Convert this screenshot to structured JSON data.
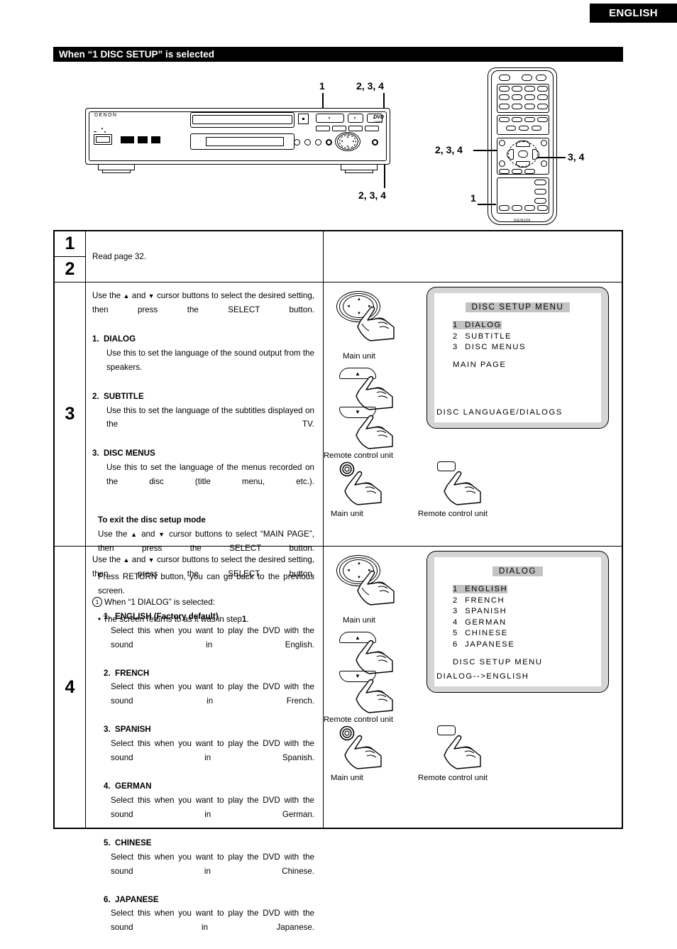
{
  "header": {
    "language_tab": "ENGLISH",
    "section_title": "When “1 DISC SETUP” is selected"
  },
  "diagram": {
    "player_brand": "DENON",
    "dvd_logo": "DVD",
    "dvd_logo_sub": "VIDEO",
    "remote_brand": "DENON",
    "callouts": {
      "player_top_left": "1",
      "player_top_right": "2, 3, 4",
      "player_bottom": "2, 3, 4",
      "remote_left": "2, 3, 4",
      "remote_right": "3, 4",
      "remote_bottom_left": "1"
    }
  },
  "steps": {
    "step1_number": "1",
    "step2_number": "2",
    "step3_number": "3",
    "step4_number": "4",
    "step12_text": "Read page 32.",
    "step3": {
      "intro_line1": "Use the",
      "intro_and": "and",
      "intro_line2": "cursor buttons to select the desired setting, then press the SELECT button.",
      "items": [
        {
          "num": "1.",
          "title": "DIALOG",
          "body": "Use this to set the language of the sound output from the speakers."
        },
        {
          "num": "2.",
          "title": "SUBTITLE",
          "body": "Use this to set the language of the subtitles displayed on the TV."
        },
        {
          "num": "3.",
          "title": "DISC MENUS",
          "body": "Use this to set the language of the menus recorded on the disc (title menu, etc.)."
        }
      ],
      "exit_heading": "To exit the disc setup mode",
      "exit_p1": "cursor buttons to select “MAIN PAGE”, then press the SELECT button.",
      "exit_p2": "Press RETURN button, you can go back to the previous screen.",
      "exit_bullet_pre": "• The screen returns to as it was in step",
      "exit_bullet_num": "1",
      "exit_bullet_post": "."
    },
    "step4": {
      "intro_line2": "cursor buttons to select the desired setting, then press the SELECT button.",
      "condition": "When “1 DIALOG” is selected:",
      "condition_marker": "1",
      "items": [
        {
          "num": "1.",
          "title": "ENGLISH (Factory default)",
          "body": "Select this when you want to play the DVD with the sound in English."
        },
        {
          "num": "2.",
          "title": "FRENCH",
          "body": "Select this when you want to play the DVD with the sound in French."
        },
        {
          "num": "3.",
          "title": "SPANISH",
          "body": "Select this when you want to play the DVD with the sound in Spanish."
        },
        {
          "num": "4.",
          "title": "GERMAN",
          "body": "Select this when you want to play the DVD with the sound in German."
        },
        {
          "num": "5.",
          "title": "CHINESE",
          "body": "Select this when you want to play the DVD with the sound in Chinese."
        },
        {
          "num": "6.",
          "title": "JAPANESE",
          "body": "Select this when you want to play the DVD with the sound in Japanese."
        }
      ]
    }
  },
  "figures": {
    "main_unit_label": "Main unit",
    "remote_label": "Remote control unit"
  },
  "osd_disc_setup": {
    "title": "DISC SETUP MENU",
    "items": [
      {
        "num": "1",
        "label": "DIALOG",
        "highlighted": true
      },
      {
        "num": "2",
        "label": "SUBTITLE",
        "highlighted": false
      },
      {
        "num": "3",
        "label": "DISC MENUS",
        "highlighted": false
      }
    ],
    "sub_item": "MAIN PAGE",
    "footer": "DISC LANGUAGE/DIALOGS"
  },
  "osd_dialog": {
    "title": "DIALOG",
    "items": [
      {
        "num": "1",
        "label": "ENGLISH",
        "highlighted": true
      },
      {
        "num": "2",
        "label": "FRENCH",
        "highlighted": false
      },
      {
        "num": "3",
        "label": "SPANISH",
        "highlighted": false
      },
      {
        "num": "4",
        "label": "GERMAN",
        "highlighted": false
      },
      {
        "num": "5",
        "label": "CHINESE",
        "highlighted": false
      },
      {
        "num": "6",
        "label": "JAPANESE",
        "highlighted": false
      }
    ],
    "sub_item": "DISC SETUP MENU",
    "footer": "DIALOG-->ENGLISH"
  },
  "colors": {
    "bar_black": "#000000",
    "osd_highlight": "#c3c3c3",
    "osd_bezel": "#d5d5d5"
  }
}
